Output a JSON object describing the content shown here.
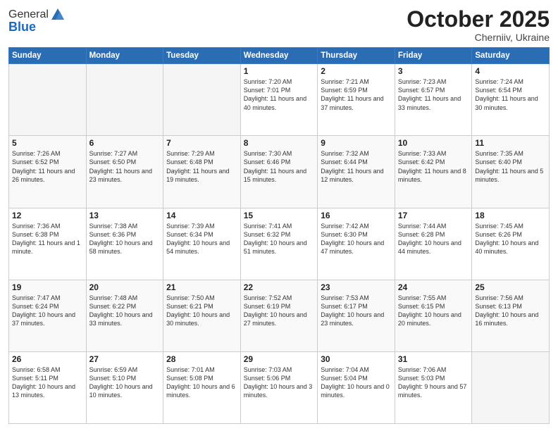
{
  "header": {
    "logo_line1": "General",
    "logo_line2": "Blue",
    "month": "October 2025",
    "location": "Cherniiv, Ukraine"
  },
  "days_of_week": [
    "Sunday",
    "Monday",
    "Tuesday",
    "Wednesday",
    "Thursday",
    "Friday",
    "Saturday"
  ],
  "weeks": [
    [
      {
        "day": "",
        "info": ""
      },
      {
        "day": "",
        "info": ""
      },
      {
        "day": "",
        "info": ""
      },
      {
        "day": "1",
        "info": "Sunrise: 7:20 AM\nSunset: 7:01 PM\nDaylight: 11 hours and 40 minutes."
      },
      {
        "day": "2",
        "info": "Sunrise: 7:21 AM\nSunset: 6:59 PM\nDaylight: 11 hours and 37 minutes."
      },
      {
        "day": "3",
        "info": "Sunrise: 7:23 AM\nSunset: 6:57 PM\nDaylight: 11 hours and 33 minutes."
      },
      {
        "day": "4",
        "info": "Sunrise: 7:24 AM\nSunset: 6:54 PM\nDaylight: 11 hours and 30 minutes."
      }
    ],
    [
      {
        "day": "5",
        "info": "Sunrise: 7:26 AM\nSunset: 6:52 PM\nDaylight: 11 hours and 26 minutes."
      },
      {
        "day": "6",
        "info": "Sunrise: 7:27 AM\nSunset: 6:50 PM\nDaylight: 11 hours and 23 minutes."
      },
      {
        "day": "7",
        "info": "Sunrise: 7:29 AM\nSunset: 6:48 PM\nDaylight: 11 hours and 19 minutes."
      },
      {
        "day": "8",
        "info": "Sunrise: 7:30 AM\nSunset: 6:46 PM\nDaylight: 11 hours and 15 minutes."
      },
      {
        "day": "9",
        "info": "Sunrise: 7:32 AM\nSunset: 6:44 PM\nDaylight: 11 hours and 12 minutes."
      },
      {
        "day": "10",
        "info": "Sunrise: 7:33 AM\nSunset: 6:42 PM\nDaylight: 11 hours and 8 minutes."
      },
      {
        "day": "11",
        "info": "Sunrise: 7:35 AM\nSunset: 6:40 PM\nDaylight: 11 hours and 5 minutes."
      }
    ],
    [
      {
        "day": "12",
        "info": "Sunrise: 7:36 AM\nSunset: 6:38 PM\nDaylight: 11 hours and 1 minute."
      },
      {
        "day": "13",
        "info": "Sunrise: 7:38 AM\nSunset: 6:36 PM\nDaylight: 10 hours and 58 minutes."
      },
      {
        "day": "14",
        "info": "Sunrise: 7:39 AM\nSunset: 6:34 PM\nDaylight: 10 hours and 54 minutes."
      },
      {
        "day": "15",
        "info": "Sunrise: 7:41 AM\nSunset: 6:32 PM\nDaylight: 10 hours and 51 minutes."
      },
      {
        "day": "16",
        "info": "Sunrise: 7:42 AM\nSunset: 6:30 PM\nDaylight: 10 hours and 47 minutes."
      },
      {
        "day": "17",
        "info": "Sunrise: 7:44 AM\nSunset: 6:28 PM\nDaylight: 10 hours and 44 minutes."
      },
      {
        "day": "18",
        "info": "Sunrise: 7:45 AM\nSunset: 6:26 PM\nDaylight: 10 hours and 40 minutes."
      }
    ],
    [
      {
        "day": "19",
        "info": "Sunrise: 7:47 AM\nSunset: 6:24 PM\nDaylight: 10 hours and 37 minutes."
      },
      {
        "day": "20",
        "info": "Sunrise: 7:48 AM\nSunset: 6:22 PM\nDaylight: 10 hours and 33 minutes."
      },
      {
        "day": "21",
        "info": "Sunrise: 7:50 AM\nSunset: 6:21 PM\nDaylight: 10 hours and 30 minutes."
      },
      {
        "day": "22",
        "info": "Sunrise: 7:52 AM\nSunset: 6:19 PM\nDaylight: 10 hours and 27 minutes."
      },
      {
        "day": "23",
        "info": "Sunrise: 7:53 AM\nSunset: 6:17 PM\nDaylight: 10 hours and 23 minutes."
      },
      {
        "day": "24",
        "info": "Sunrise: 7:55 AM\nSunset: 6:15 PM\nDaylight: 10 hours and 20 minutes."
      },
      {
        "day": "25",
        "info": "Sunrise: 7:56 AM\nSunset: 6:13 PM\nDaylight: 10 hours and 16 minutes."
      }
    ],
    [
      {
        "day": "26",
        "info": "Sunrise: 6:58 AM\nSunset: 5:11 PM\nDaylight: 10 hours and 13 minutes."
      },
      {
        "day": "27",
        "info": "Sunrise: 6:59 AM\nSunset: 5:10 PM\nDaylight: 10 hours and 10 minutes."
      },
      {
        "day": "28",
        "info": "Sunrise: 7:01 AM\nSunset: 5:08 PM\nDaylight: 10 hours and 6 minutes."
      },
      {
        "day": "29",
        "info": "Sunrise: 7:03 AM\nSunset: 5:06 PM\nDaylight: 10 hours and 3 minutes."
      },
      {
        "day": "30",
        "info": "Sunrise: 7:04 AM\nSunset: 5:04 PM\nDaylight: 10 hours and 0 minutes."
      },
      {
        "day": "31",
        "info": "Sunrise: 7:06 AM\nSunset: 5:03 PM\nDaylight: 9 hours and 57 minutes."
      },
      {
        "day": "",
        "info": ""
      }
    ]
  ]
}
